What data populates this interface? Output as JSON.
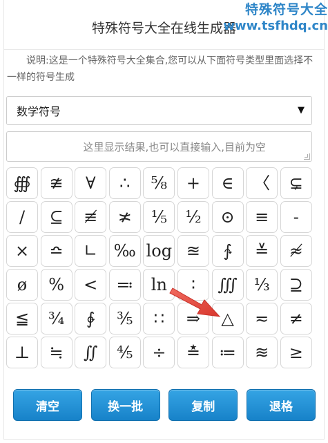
{
  "header": {
    "title": "特殊符号大全在线生成器"
  },
  "watermark": {
    "line1": "特殊符号大全",
    "line2": "www.tsfhdq.cn"
  },
  "description": "说明:这是一个特殊符号大全集合,您可以从下面符号类型里面选择不一样的符号生成",
  "category_select": {
    "value": "数学符号",
    "caret": "▼"
  },
  "output": {
    "placeholder": "这里显示结果,也可以直接输入,目前为空"
  },
  "symbols": [
    "∰",
    "≇",
    "∀",
    "∴",
    "⅝",
    "+",
    "∈",
    "〈",
    "⊊",
    "∕",
    "⊆",
    "≢",
    "≭",
    "⅕",
    "½",
    "⊙",
    "≡",
    "-",
    "×",
    "≏",
    "∟",
    "‰",
    "log",
    "≊",
    "∱",
    "≚",
    "≉",
    "ø",
    "%",
    "<",
    "≕",
    "ln",
    "∶",
    "∭",
    "⅓",
    "⊇",
    "≦",
    "¾",
    "∲",
    "⅗",
    "∷",
    "⇒",
    "△",
    "≂",
    "≠",
    "⊥",
    "≒",
    "∬",
    "⅘",
    "÷",
    "≛",
    "≔",
    "≋",
    "≥"
  ],
  "buttons": {
    "clear": "清空",
    "refresh": "换一批",
    "copy": "复制",
    "backspace": "退格"
  },
  "colors": {
    "button": "#1f8ed6",
    "watermark": "#2f86c8",
    "arrow": "#e2443a"
  }
}
